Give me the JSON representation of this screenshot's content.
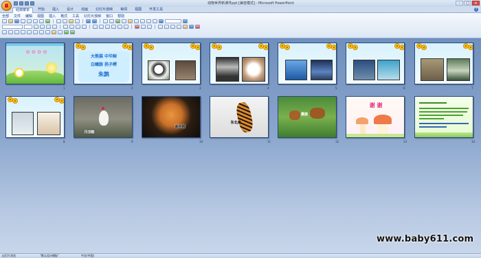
{
  "titlebar": {
    "doc_title": "动物世界新课件ppt [兼容模式] - Microsoft PowerPoint",
    "minimize": "–",
    "maximize": "□",
    "close": "×"
  },
  "tabs": [
    {
      "label": "经典菜单",
      "active": true
    },
    {
      "label": "开始",
      "active": false
    },
    {
      "label": "插入",
      "active": false
    },
    {
      "label": "设计",
      "active": false
    },
    {
      "label": "动画",
      "active": false
    },
    {
      "label": "幻灯片放映",
      "active": false
    },
    {
      "label": "审阅",
      "active": false
    },
    {
      "label": "视图",
      "active": false
    },
    {
      "label": "开发工具",
      "active": false
    }
  ],
  "menus": [
    "全部",
    "文件",
    "编辑",
    "视图",
    "插入",
    "格式",
    "工具",
    "幻灯片放映",
    "窗口",
    "帮助"
  ],
  "slides": [
    {
      "num": "1",
      "kind": "title"
    },
    {
      "num": "2",
      "kind": "names",
      "text": {
        "l1": "大熊猫  中华鲟",
        "l2": "白鳍豚  扬子鳄",
        "l3": "朱鹮"
      }
    },
    {
      "num": "3",
      "kind": "photos"
    },
    {
      "num": "4",
      "kind": "photos"
    },
    {
      "num": "5",
      "kind": "photos"
    },
    {
      "num": "6",
      "kind": "photos"
    },
    {
      "num": "7",
      "kind": "photos"
    },
    {
      "num": "8",
      "kind": "photos"
    },
    {
      "num": "9",
      "kind": "photo",
      "caption": "丹顶鹤"
    },
    {
      "num": "10",
      "kind": "photo",
      "caption": "金丝猴"
    },
    {
      "num": "11",
      "kind": "photo",
      "caption": "东北虎"
    },
    {
      "num": "12",
      "kind": "photo",
      "caption": "麋鹿"
    },
    {
      "num": "13",
      "kind": "thanks",
      "text": "谢  谢"
    },
    {
      "num": "14",
      "kind": "text"
    }
  ],
  "status": {
    "sorter": "幻灯片浏览",
    "theme": "\"默认设计模板\"",
    "lang": "中文(中国)"
  },
  "watermark": "www.baby611.com",
  "colors": {
    "sorter_bg": "#7f9cc7",
    "ribbon": "#dce7f5",
    "office_button": "#f29b20"
  }
}
